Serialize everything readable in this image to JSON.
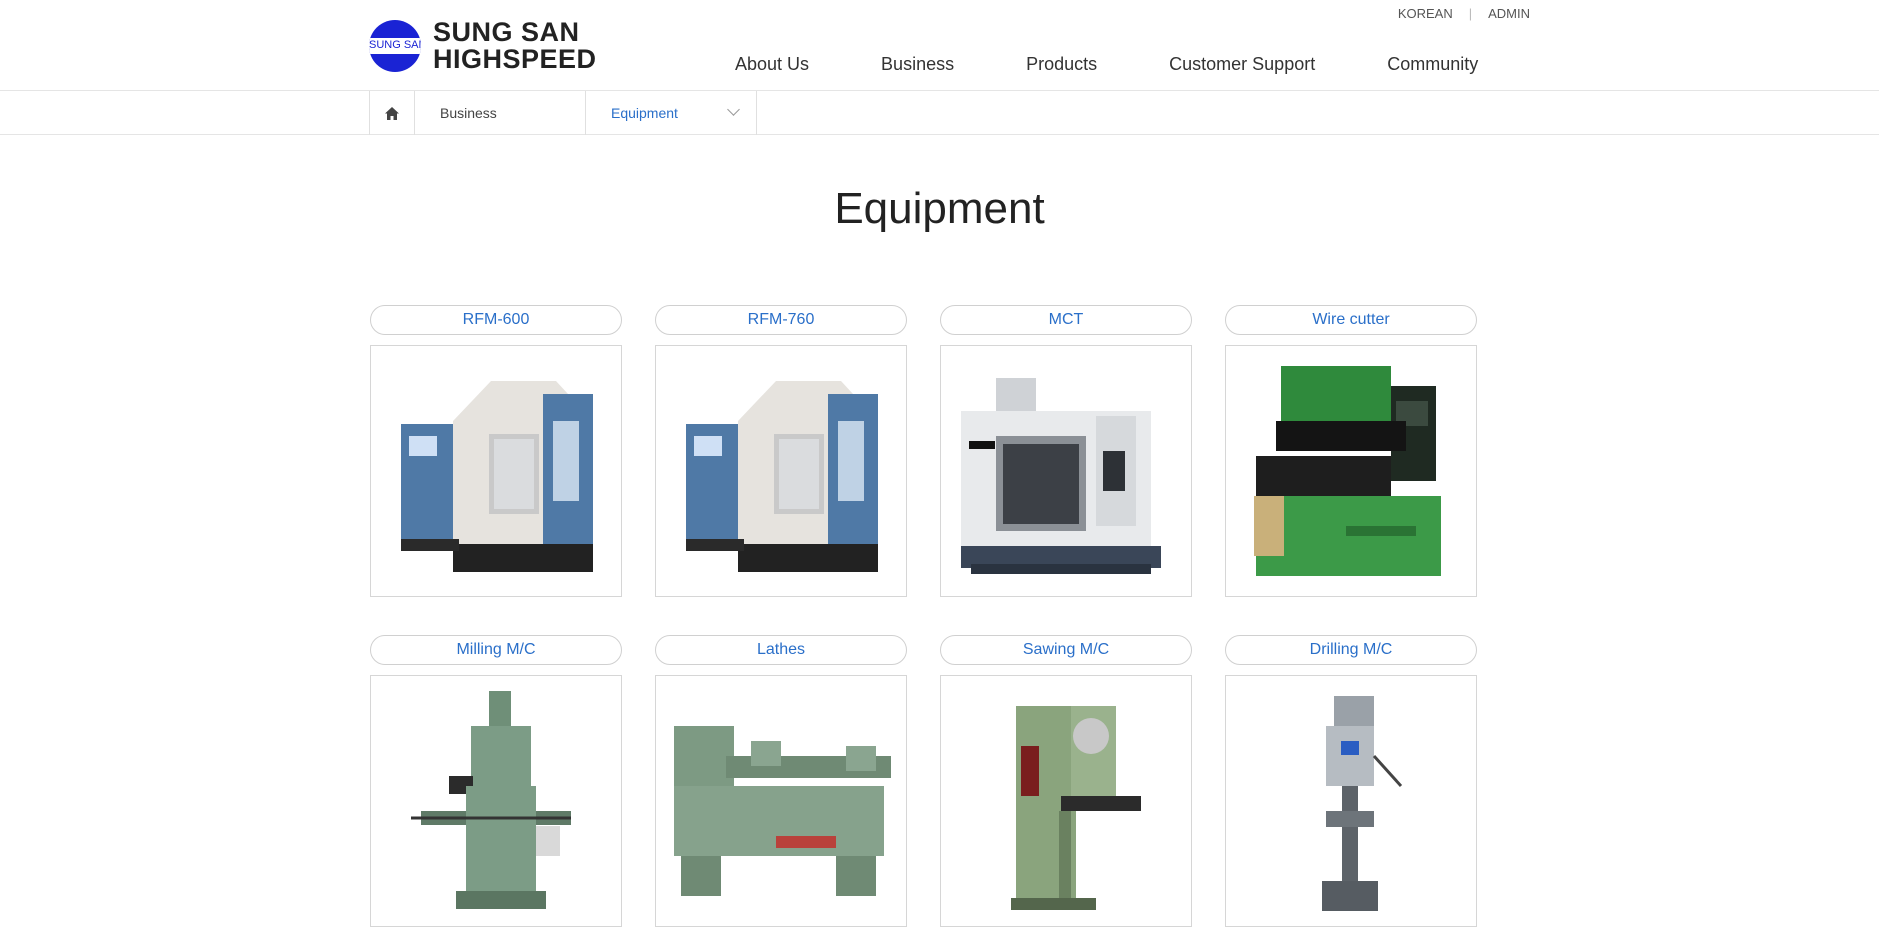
{
  "header": {
    "logo_line1": "SUNG SAN",
    "logo_line2": "HIGHSPEED",
    "logo_mark_text": "SUNG SAN",
    "util_links": [
      "KOREAN",
      "ADMIN"
    ],
    "nav": [
      "About Us",
      "Business",
      "Products",
      "Customer Support",
      "Community"
    ]
  },
  "breadcrumb": {
    "home_icon": "home-icon",
    "section": "Business",
    "current": "Equipment"
  },
  "page": {
    "title": "Equipment"
  },
  "equipment": [
    {
      "label": "RFM-600",
      "image": "cnc-machine-blue-photo"
    },
    {
      "label": "RFM-760",
      "image": "cnc-machine-blue-photo"
    },
    {
      "label": "MCT",
      "image": "machining-center-photo"
    },
    {
      "label": "Wire cutter",
      "image": "wire-cutter-photo"
    },
    {
      "label": "Milling M/C",
      "image": "milling-machine-photo"
    },
    {
      "label": "Lathes",
      "image": "lathe-photo"
    },
    {
      "label": "Sawing M/C",
      "image": "band-saw-photo"
    },
    {
      "label": "Drilling M/C",
      "image": "drill-press-photo"
    }
  ],
  "colors": {
    "accent": "#2a6fc9",
    "logo_blue": "#1a23d4"
  }
}
